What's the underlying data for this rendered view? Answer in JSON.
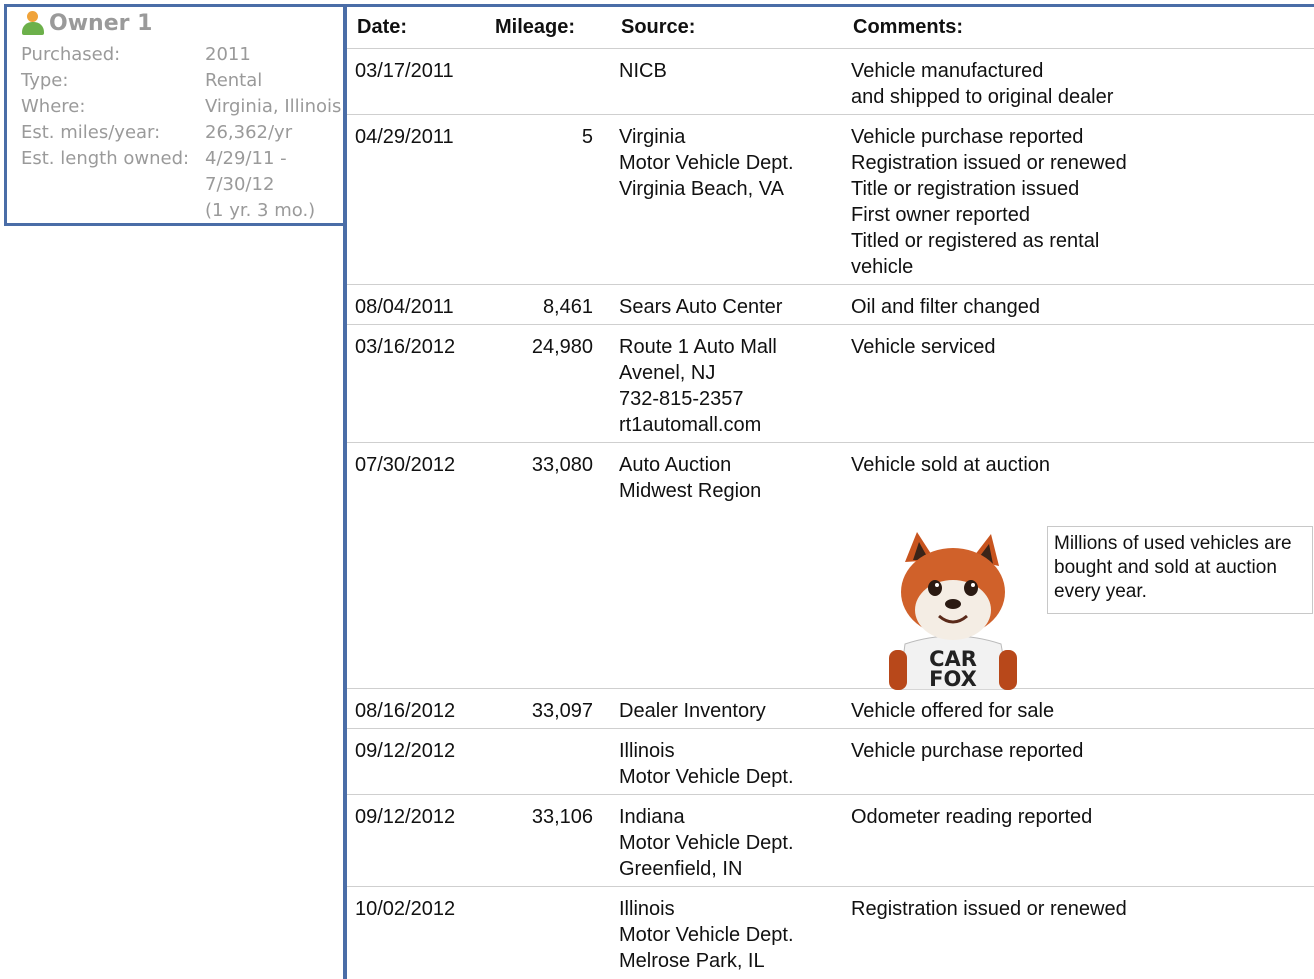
{
  "owner": {
    "title": "Owner 1",
    "rows": [
      {
        "label": "Purchased:",
        "value": "2011"
      },
      {
        "label": "Type:",
        "value": "Rental"
      },
      {
        "label": "Where:",
        "value": "Virginia, Illinois"
      },
      {
        "label": "Est. miles/year:",
        "value": "26,362/yr"
      },
      {
        "label": "Est. length owned:",
        "value": "4/29/11 -\n7/30/12\n(1 yr. 3 mo.)"
      }
    ]
  },
  "table": {
    "headers": {
      "date": "Date:",
      "mileage": "Mileage:",
      "source": "Source:",
      "comments": "Comments:"
    },
    "rows": [
      {
        "date": "03/17/2011",
        "mileage": "",
        "source": "NICB",
        "comments": "Vehicle manufactured\nand shipped to original dealer"
      },
      {
        "date": "04/29/2011",
        "mileage": "5",
        "source": "Virginia\nMotor Vehicle Dept.\nVirginia Beach, VA",
        "comments": "Vehicle purchase reported\nRegistration issued or renewed\nTitle or registration issued\nFirst owner reported\nTitled or registered as rental\nvehicle"
      },
      {
        "date": "08/04/2011",
        "mileage": "8,461",
        "source": "Sears Auto Center",
        "comments": "Oil and filter changed"
      },
      {
        "date": "03/16/2012",
        "mileage": "24,980",
        "source": "Route 1 Auto Mall\nAvenel, NJ\n732-815-2357\nrt1automall.com",
        "comments": "Vehicle serviced"
      },
      {
        "date": "07/30/2012",
        "mileage": "33,080",
        "source": "Auto Auction\nMidwest Region",
        "comments": "Vehicle sold at auction"
      },
      {
        "date": "08/16/2012",
        "mileage": "33,097",
        "source": "Dealer Inventory",
        "comments": "Vehicle offered for sale"
      },
      {
        "date": "09/12/2012",
        "mileage": "",
        "source": "Illinois\nMotor Vehicle Dept.",
        "comments": "Vehicle purchase reported"
      },
      {
        "date": "09/12/2012",
        "mileage": "33,106",
        "source": "Indiana\nMotor Vehicle Dept.\nGreenfield, IN",
        "comments": "Odometer reading reported"
      },
      {
        "date": "10/02/2012",
        "mileage": "",
        "source": "Illinois\nMotor Vehicle Dept.\nMelrose Park, IL",
        "comments": "Registration issued or renewed"
      }
    ]
  },
  "promo": {
    "text": "Millions of used vehicles are bought and sold at auction every year.",
    "shirt_line1": "CAR",
    "shirt_line2": "FOX"
  }
}
